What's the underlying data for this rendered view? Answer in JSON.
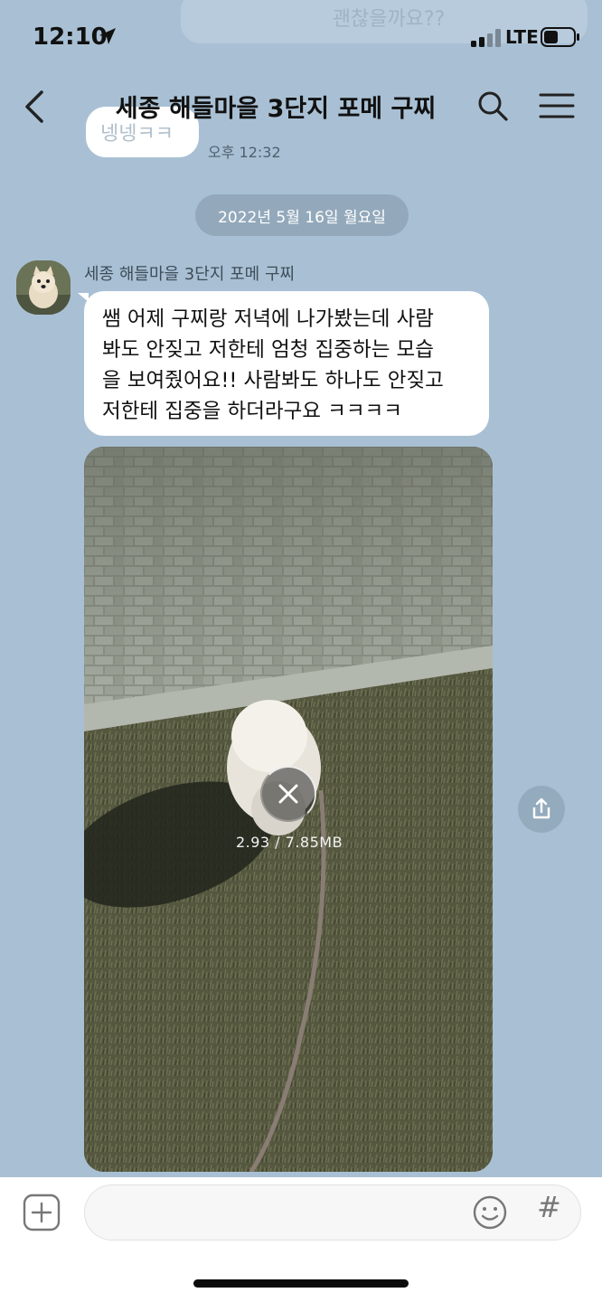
{
  "status_bar": {
    "time": "12:10",
    "network": "LTE"
  },
  "background_messages": {
    "top_partial_text": "괜찮을까요??",
    "left_partial_text": "넹넹ㅋㅋ",
    "left_time": "오후 12:32"
  },
  "header": {
    "title": "세종 해들마을 3단지 포메 구찌"
  },
  "date_divider": "2022년 5월 16일 월요일",
  "message": {
    "sender": "세종 해들마을 3단지 포메 구찌",
    "lines": [
      "쌤 어제 구찌랑 저녁에 나가봤는데 사람",
      "봐도 안짖고 저한테 엄청 집중하는 모습",
      "을 보여줬어요!! 사람봐도 하나도 안짖고",
      "저한테 집중을 하더라구요 ㅋㅋㅋㅋ"
    ]
  },
  "video": {
    "progress_text": "2.93 / 7.85MB",
    "download_progress": 0.373
  },
  "input_bar": {
    "placeholder": ""
  },
  "colors": {
    "chat_background": "#a9c0d4",
    "bubble": "#ffffff",
    "date_pill": "#93a9bb"
  },
  "icons": [
    "location-arrow-icon",
    "signal-icon",
    "battery-icon",
    "back-chevron-icon",
    "search-icon",
    "menu-icon",
    "close-icon",
    "share-icon",
    "plus-icon",
    "emoji-icon",
    "hashtag-icon"
  ]
}
